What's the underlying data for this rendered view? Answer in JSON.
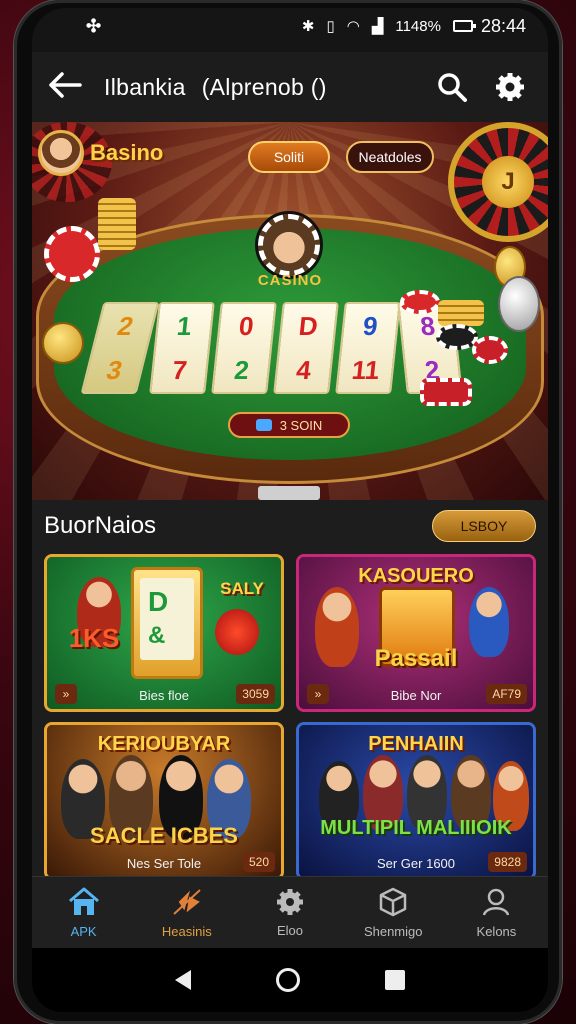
{
  "status": {
    "time": "28:44",
    "battery": "1148%"
  },
  "appbar": {
    "title_part1": "Ilbankia",
    "title_part2": "(Alprenob ()",
    "back_icon": "arrow-left-icon",
    "search_icon": "search-icon",
    "settings_icon": "gear-icon"
  },
  "hero": {
    "brand": "Basino",
    "pill_gold": "Soliti",
    "pill_dark": "Neatdoles",
    "table_label": "CASINO",
    "roulette_center": "J",
    "bet": "3 SOIN",
    "reels": [
      [
        "2",
        "3"
      ],
      [
        "1",
        "7"
      ],
      [
        "0",
        "2"
      ],
      [
        "D",
        "4"
      ],
      [
        "9",
        "11"
      ],
      [
        "8",
        "2"
      ]
    ]
  },
  "section": {
    "title": "BuorNaios",
    "ready_button": "LSBOY",
    "cards": [
      {
        "title": "SALY",
        "sub": "1KS",
        "footer": "Bies floe",
        "badge": "3059",
        "chev": "»"
      },
      {
        "title": "KASOUERO",
        "sub": "Passail",
        "footer": "Bibe Nor",
        "badge": "AF79",
        "chev": "»"
      },
      {
        "title": "KERIOUBYAR",
        "sub": "SACLE ICBES",
        "footer": "Nes Ser Tole",
        "badge": "520",
        "chev": ""
      },
      {
        "title": "PENHAIIN",
        "sub": "MULTIPIL MALIIIOIK",
        "footer": "Ser Ger 1600",
        "badge": "9828",
        "chev": ""
      }
    ]
  },
  "nav": {
    "items": [
      {
        "label": "APK",
        "icon": "home-icon"
      },
      {
        "label": "Heasinis",
        "icon": "leaf-icon"
      },
      {
        "label": "Eloo",
        "icon": "gear-icon"
      },
      {
        "label": "Shenmigo",
        "icon": "box-icon"
      },
      {
        "label": "Kelons",
        "icon": "user-icon"
      }
    ]
  },
  "colors": {
    "accent": "#56b4f0",
    "gold": "#e8a830",
    "felt": "#1a6e24"
  }
}
